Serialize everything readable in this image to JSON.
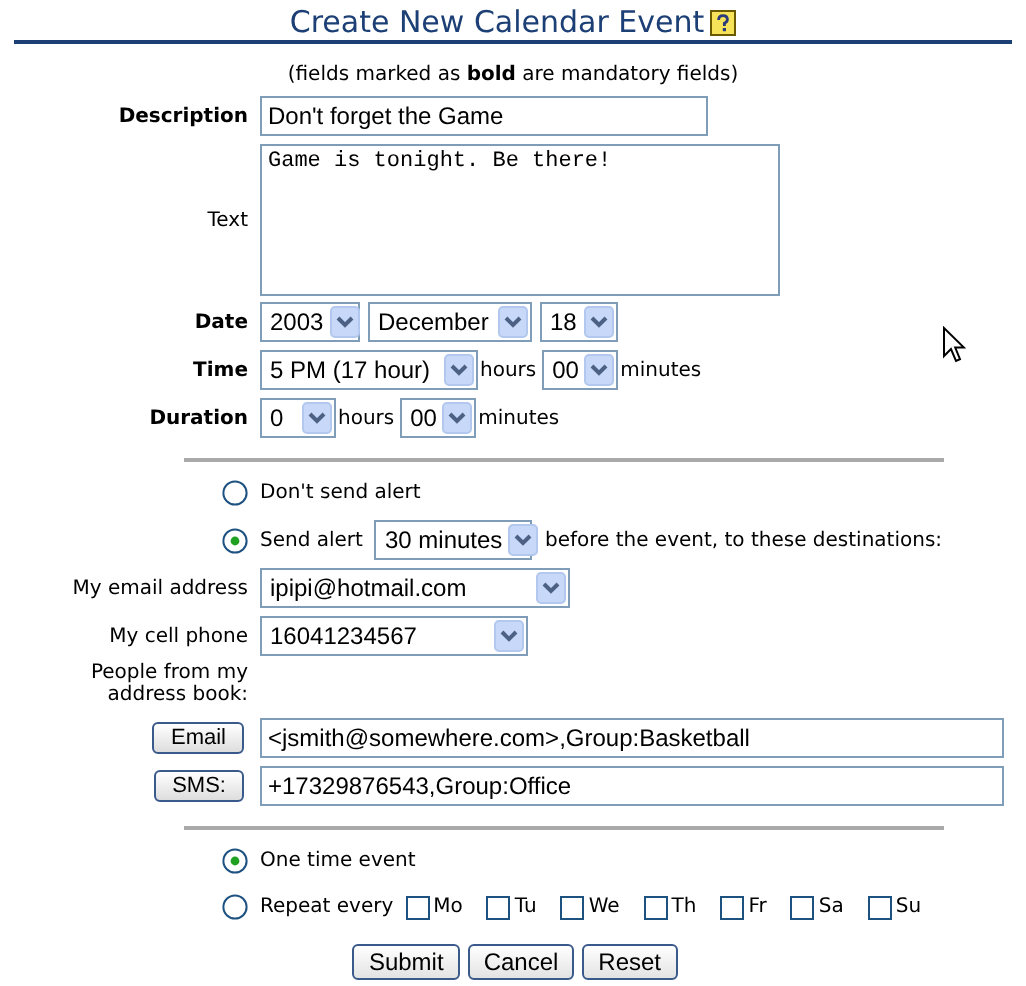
{
  "title": "Create New Calendar Event",
  "note": "(fields marked as **bold** are mandatory fields)",
  "description": {
    "label": "Description",
    "required": true,
    "value": "Don't forget the Game"
  },
  "text": {
    "label": "Text",
    "required": false,
    "value": "Game is tonight. Be there!"
  },
  "date": {
    "label": "Date",
    "required": true,
    "year": "2003",
    "month": "December",
    "day": "18"
  },
  "time": {
    "label": "Time",
    "required": true,
    "hour": "5 PM (17 hour)",
    "hours_unit": "hours",
    "minute": "00",
    "minutes_unit": "minutes"
  },
  "duration": {
    "label": "Duration",
    "required": true,
    "hour": "0",
    "hours_unit": "hours",
    "minute": "00",
    "minutes_unit": "minutes"
  },
  "alert_options": [
    {
      "label": "Don't send alert",
      "selected": false
    },
    {
      "label": "Send alert",
      "selected": true,
      "lead_time": "30 minutes",
      "suffix": "before the event, to these destinations:"
    }
  ],
  "email": {
    "label": "My email address",
    "required": false,
    "value": "ipipi@hotmail.com"
  },
  "cell_phone": {
    "label": "My cell phone",
    "required": false,
    "value": "16041234567"
  },
  "address_book": {
    "label": "People from my address book:",
    "rows": [
      {
        "button": "Email",
        "value": "<jsmith@somewhere.com>,Group:Basketball"
      },
      {
        "button": "SMS:",
        "value": "+17329876543,Group:Office"
      }
    ]
  },
  "recurrence": [
    {
      "label": "One time event",
      "selected": true
    },
    {
      "label": "Repeat every",
      "selected": false,
      "days": [
        {
          "label": "Mo",
          "checked": false
        },
        {
          "label": "Tu",
          "checked": false
        },
        {
          "label": "We",
          "checked": false
        },
        {
          "label": "Th",
          "checked": false
        },
        {
          "label": "Fr",
          "checked": false
        },
        {
          "label": "Sa",
          "checked": false
        },
        {
          "label": "Su",
          "checked": false
        }
      ]
    }
  ],
  "buttons": [
    "Submit",
    "Cancel",
    "Reset"
  ]
}
